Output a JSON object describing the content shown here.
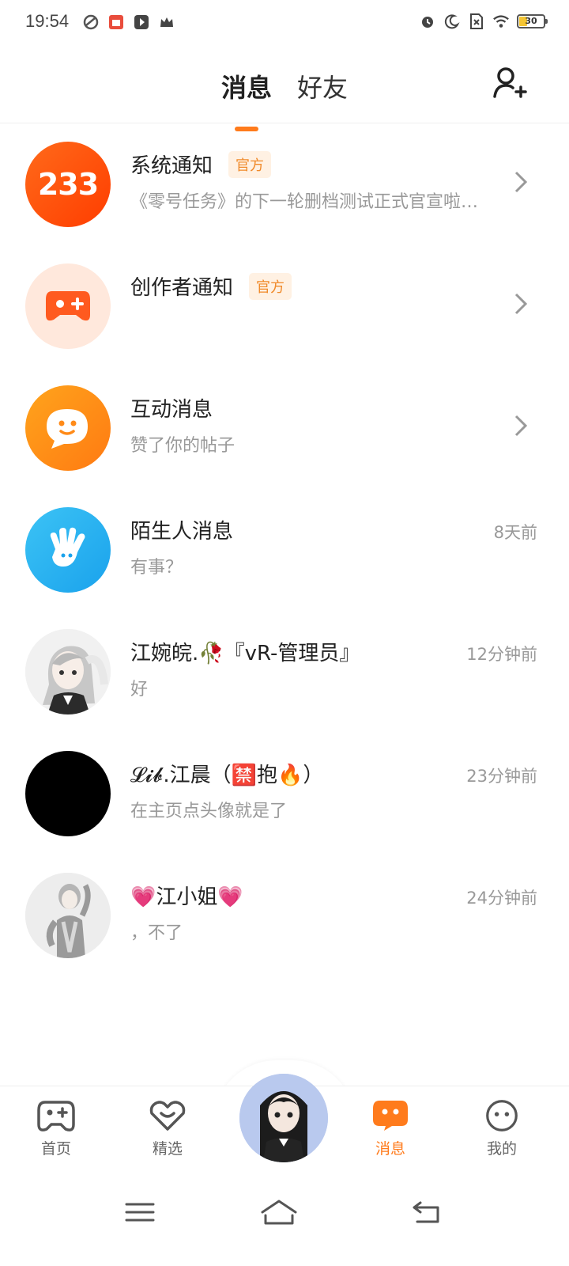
{
  "status_bar": {
    "time": "19:54",
    "battery_level": "30",
    "battery_color": "#f4c534",
    "left_icons": [
      "leaf-icon",
      "shop-icon",
      "play-icon",
      "crown-icon"
    ],
    "right_icons": [
      "alarm-icon",
      "moon-icon",
      "sim-off-icon",
      "wifi-icon",
      "battery-icon"
    ]
  },
  "header": {
    "tabs": [
      {
        "label": "消息",
        "active": true
      },
      {
        "label": "好友",
        "active": false
      }
    ],
    "add_friend_icon": "add-user-icon",
    "accent_color": "#ff7b1c"
  },
  "messages": [
    {
      "title": "系统通知",
      "badge": "官方",
      "subtitle": "《零号任务》的下一轮删档测试正式官宣啦…",
      "time": "",
      "avatar": "233",
      "chevron": true
    },
    {
      "title": "创作者通知",
      "badge": "官方",
      "subtitle": "",
      "time": "",
      "avatar": "gamepad-plus-icon",
      "chevron": true
    },
    {
      "title": "互动消息",
      "badge": "",
      "subtitle": "赞了你的帖子",
      "time": "",
      "avatar": "smile-bubble-icon",
      "chevron": true
    },
    {
      "title": "陌生人消息",
      "badge": "",
      "subtitle": "有事？",
      "time": "8天前",
      "avatar": "hand-wave-icon",
      "chevron": false
    },
    {
      "title": "江婉皖.🥀『vR-管理员』",
      "badge": "",
      "subtitle": "好",
      "time": "12分钟前",
      "avatar": "user-avatar",
      "chevron": false
    },
    {
      "title": "𝓛𝓲𝓫.江晨（🈲抱🔥）",
      "badge": "",
      "subtitle": "在主页点头像就是了",
      "time": "23分钟前",
      "avatar": "black-avatar",
      "chevron": false
    },
    {
      "title": "💗江小姐💗",
      "badge": "",
      "subtitle": "，不了",
      "time": "24分钟前",
      "avatar": "user-avatar",
      "chevron": false
    }
  ],
  "bottom_nav": {
    "items": [
      {
        "label": "首页",
        "icon": "gamepad-icon",
        "active": false
      },
      {
        "label": "精选",
        "icon": "heart-badge-icon",
        "active": false
      },
      {
        "label": "消息",
        "icon": "chat-icon",
        "active": true
      },
      {
        "label": "我的",
        "icon": "face-icon",
        "active": false
      }
    ],
    "center_icon": "profile-avatar"
  },
  "system_nav": [
    "menu-icon",
    "home-icon",
    "back-icon"
  ]
}
